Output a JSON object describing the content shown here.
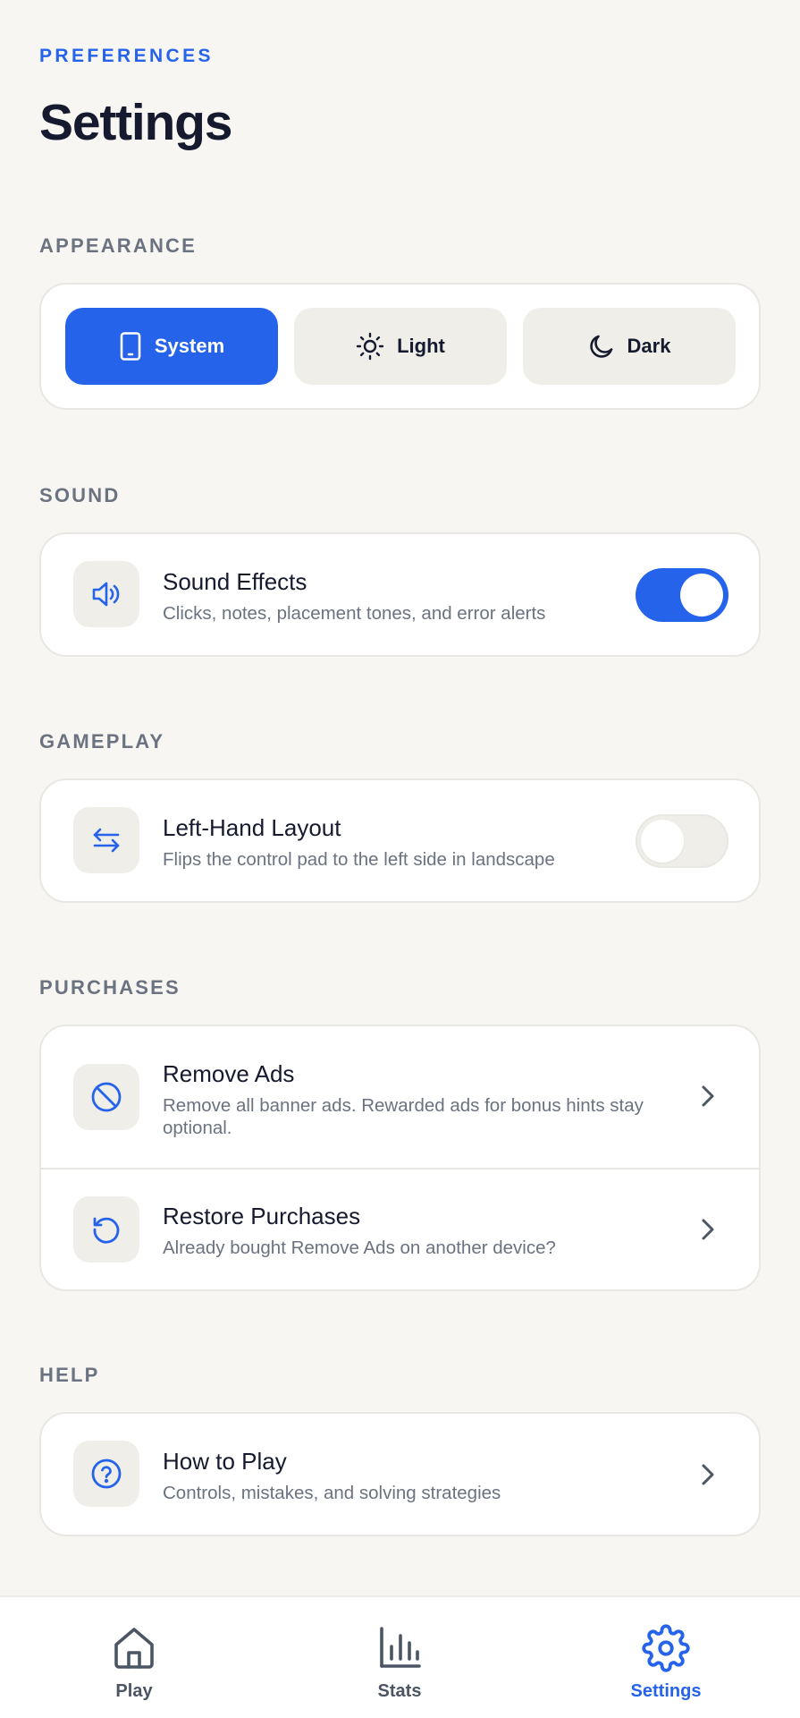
{
  "header": {
    "eyebrow": "PREFERENCES",
    "title": "Settings"
  },
  "appearance": {
    "section_label": "APPEARANCE",
    "options": [
      {
        "label": "System",
        "icon": "phone-icon",
        "selected": true
      },
      {
        "label": "Light",
        "icon": "sun-icon",
        "selected": false
      },
      {
        "label": "Dark",
        "icon": "moon-icon",
        "selected": false
      }
    ]
  },
  "sound": {
    "section_label": "SOUND",
    "sound_effects": {
      "title": "Sound Effects",
      "subtitle": "Clicks, notes, placement tones, and error alerts",
      "icon": "speaker-icon",
      "enabled": true
    }
  },
  "gameplay": {
    "section_label": "GAMEPLAY",
    "left_hand": {
      "title": "Left-Hand Layout",
      "subtitle": "Flips the control pad to the left side in landscape",
      "icon": "swap-arrows-icon",
      "enabled": false
    }
  },
  "purchases": {
    "section_label": "PURCHASES",
    "remove_ads": {
      "title": "Remove Ads",
      "subtitle": "Remove all banner ads. Rewarded ads for bonus hints stay optional.",
      "icon": "block-icon"
    },
    "restore": {
      "title": "Restore Purchases",
      "subtitle": "Already bought Remove Ads on another device?",
      "icon": "restore-icon"
    }
  },
  "help": {
    "section_label": "HELP",
    "how_to_play": {
      "title": "How to Play",
      "subtitle": "Controls, mistakes, and solving strategies",
      "icon": "question-circle-icon"
    }
  },
  "bottom_nav": {
    "items": [
      {
        "label": "Play",
        "icon": "home-icon",
        "active": false
      },
      {
        "label": "Stats",
        "icon": "bar-chart-icon",
        "active": false
      },
      {
        "label": "Settings",
        "icon": "gear-icon",
        "active": true
      }
    ]
  },
  "colors": {
    "accent": "#2563eb",
    "background": "#f7f6f2",
    "card": "#ffffff",
    "muted_text": "#6b7280"
  }
}
